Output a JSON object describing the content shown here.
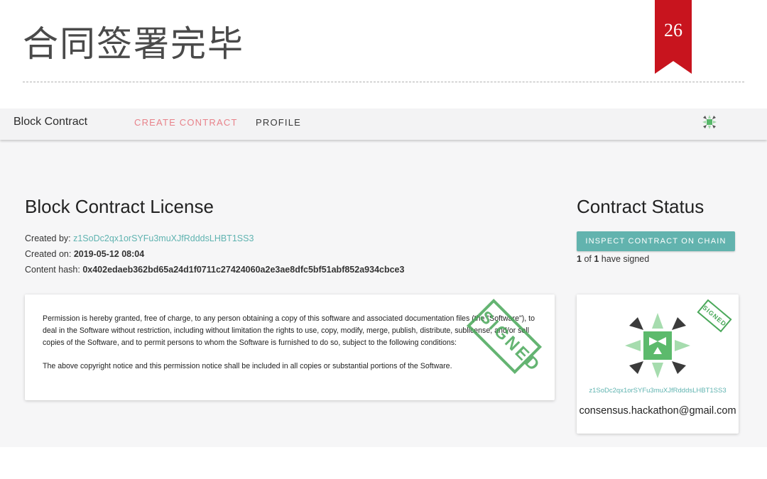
{
  "slide": {
    "title": "合同签署完毕",
    "page_number": "26",
    "ribbon_color": "#c8141e"
  },
  "navbar": {
    "brand": "Block Contract",
    "links": [
      {
        "label": "CREATE CONTRACT",
        "active": true
      },
      {
        "label": "PROFILE",
        "active": false
      }
    ],
    "avatar_icon": "identicon-avatar-icon"
  },
  "license": {
    "title": "Block Contract License",
    "created_by_label": "Created by:",
    "created_by_value": "z1SoDc2qx1orSYFu3muXJfRdddsLHBT1SS3",
    "created_on_label": "Created on:",
    "created_on_value": "2019-05-12 08:04",
    "content_hash_label": "Content hash:",
    "content_hash_value": "0x402edaeb362bd65a24d1f0711c27424060a2e3ae8dfc5bf51abf852a934cbce3",
    "paragraphs": [
      "Permission is hereby granted, free of charge, to any person obtaining a copy of this software and associated documentation files (the \"Software\"), to deal in the Software without restriction, including without limitation the rights to use, copy, modify, merge, publish, distribute, sublicense, and/or sell copies of the Software, and to permit persons to whom the Software is furnished to do so, subject to the following conditions:",
      "The above copyright notice and this permission notice shall be included in all copies or substantial portions of the Software."
    ],
    "stamp": "SIGNED"
  },
  "status": {
    "title": "Contract Status",
    "inspect_button": "INSPECT CONTRACT ON CHAIN",
    "signed_count": "1",
    "signed_total": "1",
    "signed_text": "have signed",
    "of_text": "of"
  },
  "signer": {
    "id": "z1SoDc2qx1orSYFu3muXJfRdddsLHBT1SS3",
    "email": "consensus.hackathon@gmail.com",
    "stamp": "SIGNED",
    "identicon_icon": "identicon-icon"
  },
  "colors": {
    "accent": "#62b3ae",
    "link": "#5fb3b0",
    "active_nav": "#e8828a",
    "stamp_green": "#4aa85a"
  }
}
